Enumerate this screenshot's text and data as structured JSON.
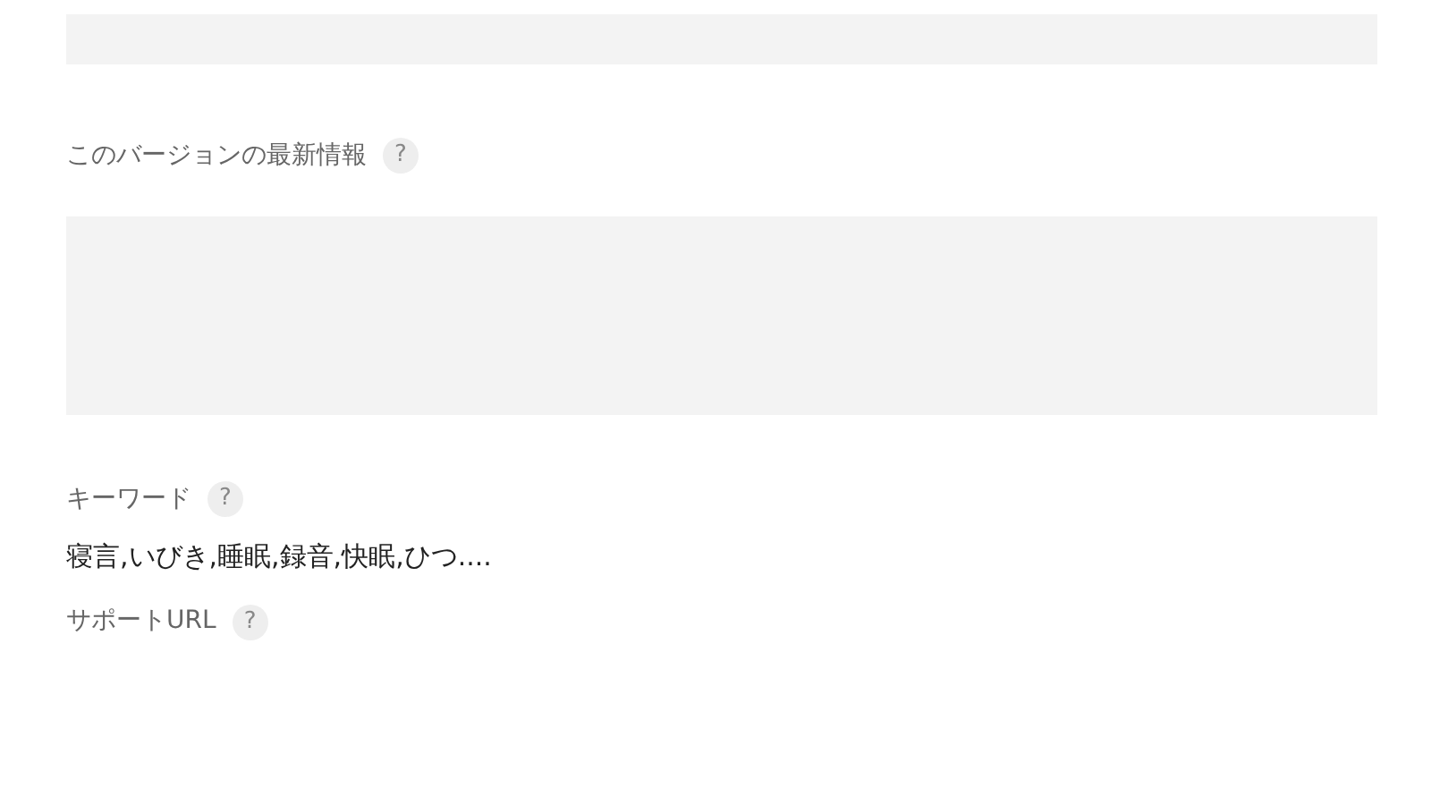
{
  "items": [
    {
      "kind": "short_box"
    },
    {
      "kind": "label",
      "label": "このバージョンの最新情報",
      "help": "?"
    },
    {
      "kind": "tall_box"
    },
    {
      "kind": "label",
      "label": "キーワード",
      "help": "?"
    },
    {
      "kind": "text",
      "text": "寝言,いびき,睡眠,録音,快眠,ひつ...."
    },
    {
      "kind": "label",
      "label": "サポートURL",
      "help": "?"
    }
  ]
}
